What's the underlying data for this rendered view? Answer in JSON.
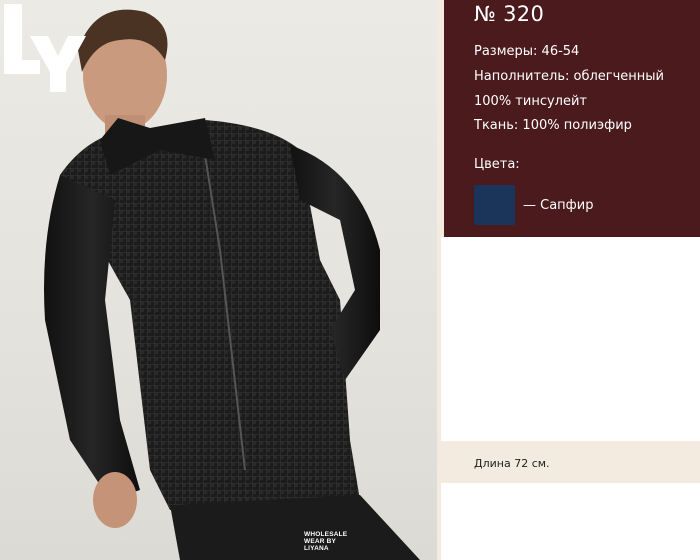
{
  "product": {
    "number": "№ 320",
    "specs": [
      "Размеры: 46-54",
      "Наполнитель: облегченный",
      "100% тинсулейт",
      "Ткань: 100% полиэфир"
    ],
    "colors_label": "Цвета:",
    "colors": [
      {
        "name": "— Сапфир",
        "hex": "#1b3459"
      }
    ],
    "length": "Длина 72 см."
  },
  "brand": {
    "logo_text": "LY",
    "caption_lines": [
      "WHOLESALE",
      "WEAR BY",
      "LIYANA"
    ]
  },
  "theme": {
    "panel_bg": "#4b1a1c",
    "page_bg": "#f3ebdf"
  }
}
